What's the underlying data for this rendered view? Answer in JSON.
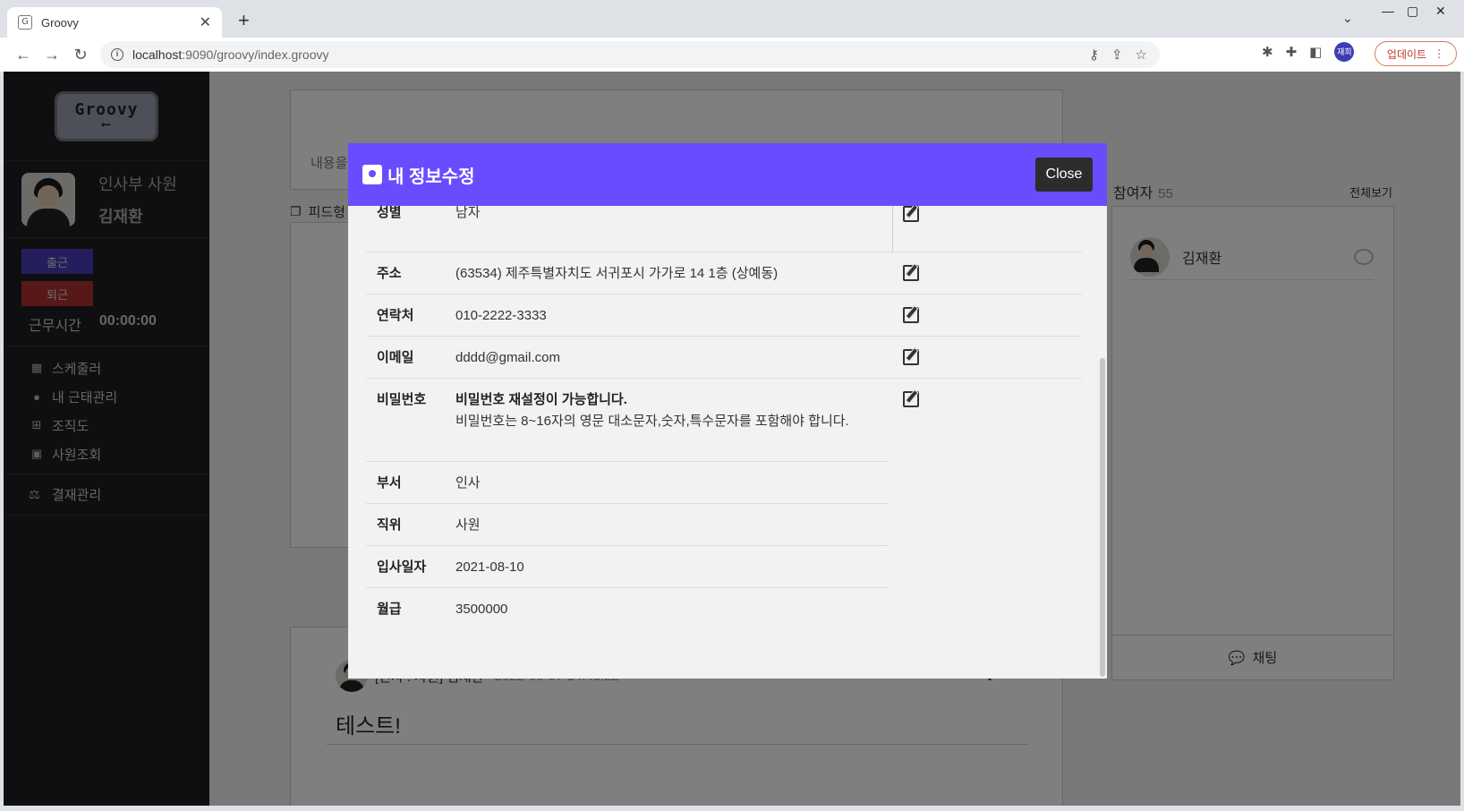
{
  "browser": {
    "tab_title": "Groovy",
    "tab_favicon": "G",
    "url_host": "localhost",
    "url_rest": ":9090/groovy/index.groovy",
    "profile_label": "재희",
    "update_label": "업데이트"
  },
  "sidebar": {
    "logo_text": "Groovy",
    "user_dept": "인사부 사원",
    "user_name": "김재환",
    "checkin_label": "출근",
    "checkout_label": "퇴근",
    "worktime_label": "근무시간",
    "worktime_value": "00:00:00",
    "menu": [
      {
        "label": "스케줄러",
        "icon": "calendar-icon"
      },
      {
        "label": "내 근태관리",
        "icon": "user-clock-icon"
      },
      {
        "label": "조직도",
        "icon": "sitemap-icon"
      },
      {
        "label": "사원조회",
        "icon": "id-card-icon"
      }
    ],
    "approval_label": "결재관리"
  },
  "feed": {
    "placeholder": "내용을",
    "section_label": "피드형",
    "post_author": "[인사 : 사원] 김재환",
    "post_time": "2022-06-07 14:43:22",
    "post_body": "테스트!"
  },
  "participants": {
    "label": "참여자",
    "count": "55",
    "view_all": "전체보기",
    "member_name": "김재환",
    "chat_label": "채팅"
  },
  "modal": {
    "title": "내 정보수정",
    "close_label": "Close",
    "rows": [
      {
        "key": "성별",
        "value": "남자"
      },
      {
        "key": "주소",
        "value": "(63534) 제주특별자치도 서귀포시 가가로 14 1층 (상예동)"
      },
      {
        "key": "연락처",
        "value": "010-2222-3333"
      },
      {
        "key": "이메일",
        "value": "dddd@gmail.com"
      },
      {
        "key": "비밀번호",
        "value_strong": "비밀번호 재설정이 가능합니다.",
        "value": "비밀번호는 8~16자의 영문 대소문자,숫자,특수문자를 포함해야 합니다."
      },
      {
        "key": "부서",
        "value": "인사"
      },
      {
        "key": "직위",
        "value": "사원"
      },
      {
        "key": "입사일자",
        "value": "2021-08-10"
      },
      {
        "key": "월급",
        "value": "3500000"
      }
    ]
  },
  "colors": {
    "modal_header": "#6a4cff",
    "sidebar_bg": "#1e1e22",
    "checkin": "#4a3db8",
    "checkout": "#b03030"
  }
}
